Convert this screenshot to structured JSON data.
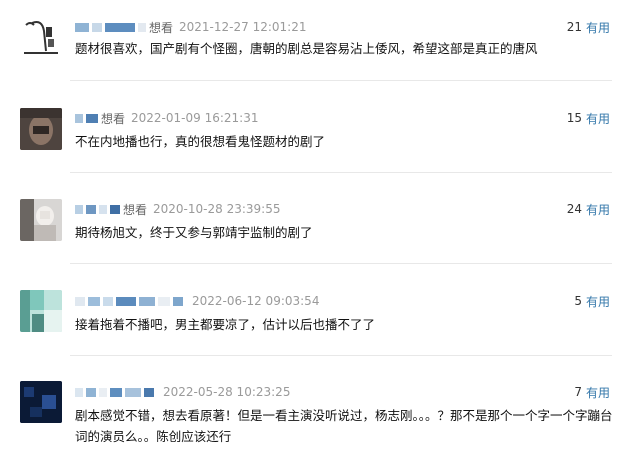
{
  "comments": [
    {
      "rating": "想看",
      "time": "2021-12-27 12:01:21",
      "votes": "21",
      "vote_label": "有用",
      "text": "题材很喜欢，国产剧有个怪圈，唐朝的剧总是容易沾上倭风，希望这部是真正的唐风"
    },
    {
      "rating": "想看",
      "time": "2022-01-09 16:21:31",
      "votes": "15",
      "vote_label": "有用",
      "text": "不在内地播也行，真的很想看鬼怪题材的剧了"
    },
    {
      "rating": "想看",
      "time": "2020-10-28 23:39:55",
      "votes": "24",
      "vote_label": "有用",
      "text": "期待杨旭文，终于又参与郭靖宇监制的剧了"
    },
    {
      "rating": "",
      "time": "2022-06-12 09:03:54",
      "votes": "5",
      "vote_label": "有用",
      "text": "接着拖着不播吧，男主都要凉了，估计以后也播不了了"
    },
    {
      "rating": "",
      "time": "2022-05-28 10:23:25",
      "votes": "7",
      "vote_label": "有用",
      "text": "剧本感觉不错，想去看原著！但是一看主演没听说过，杨志刚。。。？那不是那个一个字一个字蹦台词的演员么。。陈创应该还行"
    }
  ],
  "colors": {
    "link": "#3377aa",
    "meta": "#9a9a9a",
    "divider": "#e8e8e8"
  },
  "avatars": [
    "line-drawing-avatar",
    "face-photo-avatar",
    "person-photo-avatar",
    "teal-photo-avatar",
    "dark-blue-avatar"
  ]
}
